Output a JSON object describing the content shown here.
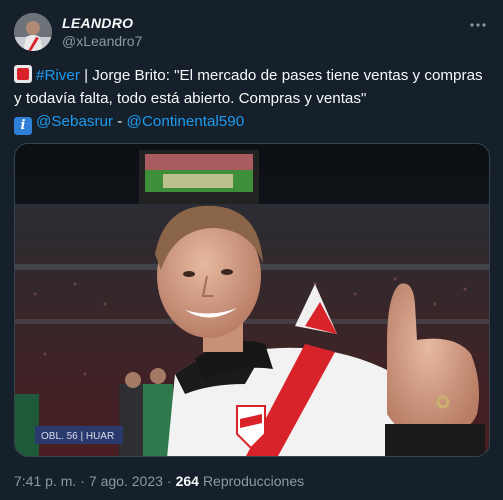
{
  "author": {
    "display_name": "LEANDRO",
    "handle": "@xLeandro7",
    "avatar_icon": "profile-avatar"
  },
  "more_icon": "more-options-icon",
  "tweet": {
    "line1_hashtag": "#River",
    "line1_text": " | Jorge Brito: \"El mercado de pases tiene ventas y compras y todavía falta, todo está abierto. Compras y ventas\"",
    "mention1": "@Sebasrur",
    "separator": " - ",
    "mention2": "@Continental590",
    "info_glyph": "i"
  },
  "media": {
    "description_icon": "photo-man-river-plate-stadium-thumbs-up",
    "scoreboard_text": "OBL. 56 | HUAR"
  },
  "footer": {
    "time": "7:41 p. m.",
    "dot": "·",
    "date": "7 ago. 2023",
    "views_count": "264",
    "views_label": "Reproducciones"
  },
  "colors": {
    "background": "#15202b",
    "link": "#1d9bf0",
    "muted": "#8b98a5",
    "river_red": "#d8232a"
  }
}
